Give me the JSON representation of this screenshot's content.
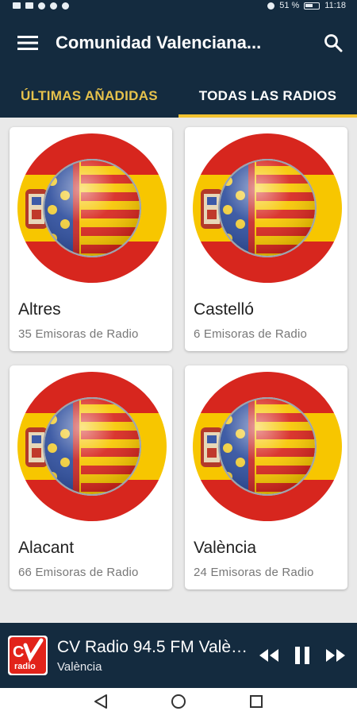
{
  "status": {
    "battery": "51 %",
    "time": "11:18"
  },
  "appbar": {
    "title": "Comunidad Valenciana..."
  },
  "tabs": [
    {
      "label": "ÚLTIMAS AÑADIDAS",
      "selected": false
    },
    {
      "label": "TODAS LAS RADIOS",
      "selected": true
    }
  ],
  "cards": [
    {
      "name": "Altres",
      "count": "35 Emisoras de Radio"
    },
    {
      "name": "Castelló",
      "count": "6 Emisoras de Radio"
    },
    {
      "name": "Alacant",
      "count": "66 Emisoras de Radio"
    },
    {
      "name": "València",
      "count": "24 Emisoras de Radio"
    }
  ],
  "player": {
    "station": "CV Radio 94.5 FM València",
    "city": "València",
    "logo_text": "radio",
    "state": "playing"
  },
  "colors": {
    "primary": "#142b3f",
    "accent": "#f2c230",
    "flag_red": "#d7261e",
    "flag_yellow": "#f7c600"
  }
}
